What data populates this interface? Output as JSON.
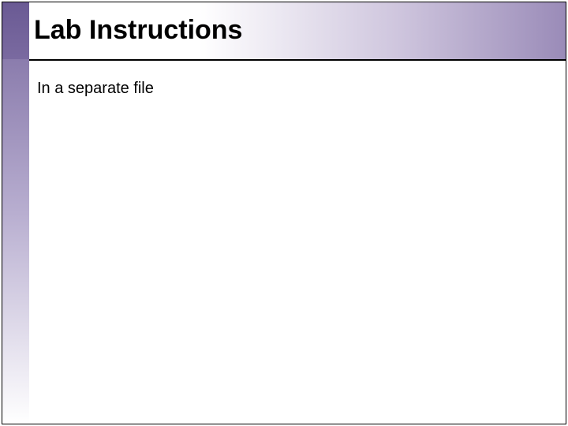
{
  "slide": {
    "title": "Lab Instructions",
    "body": "In a separate file"
  }
}
